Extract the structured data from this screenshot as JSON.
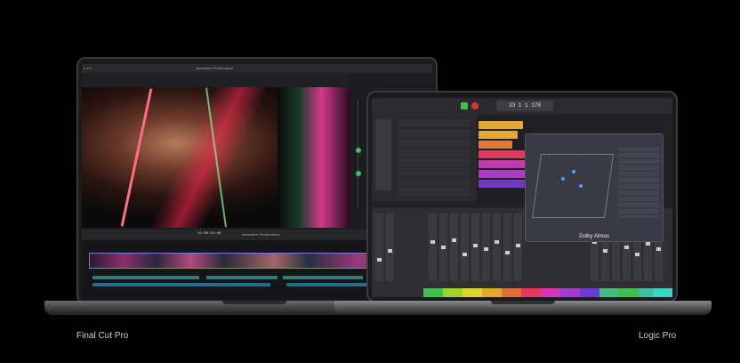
{
  "left_laptop": {
    "caption": "Final Cut Pro",
    "window": {
      "project_title": "Interactive Performance",
      "timecode": "11:00:24:00",
      "timeline_name": "Interactive Performance"
    }
  },
  "right_laptop": {
    "caption": "Logic Pro",
    "window": {
      "lcd_value": "33 1 1 178",
      "panel_title": "Dolby Atmos"
    }
  }
}
